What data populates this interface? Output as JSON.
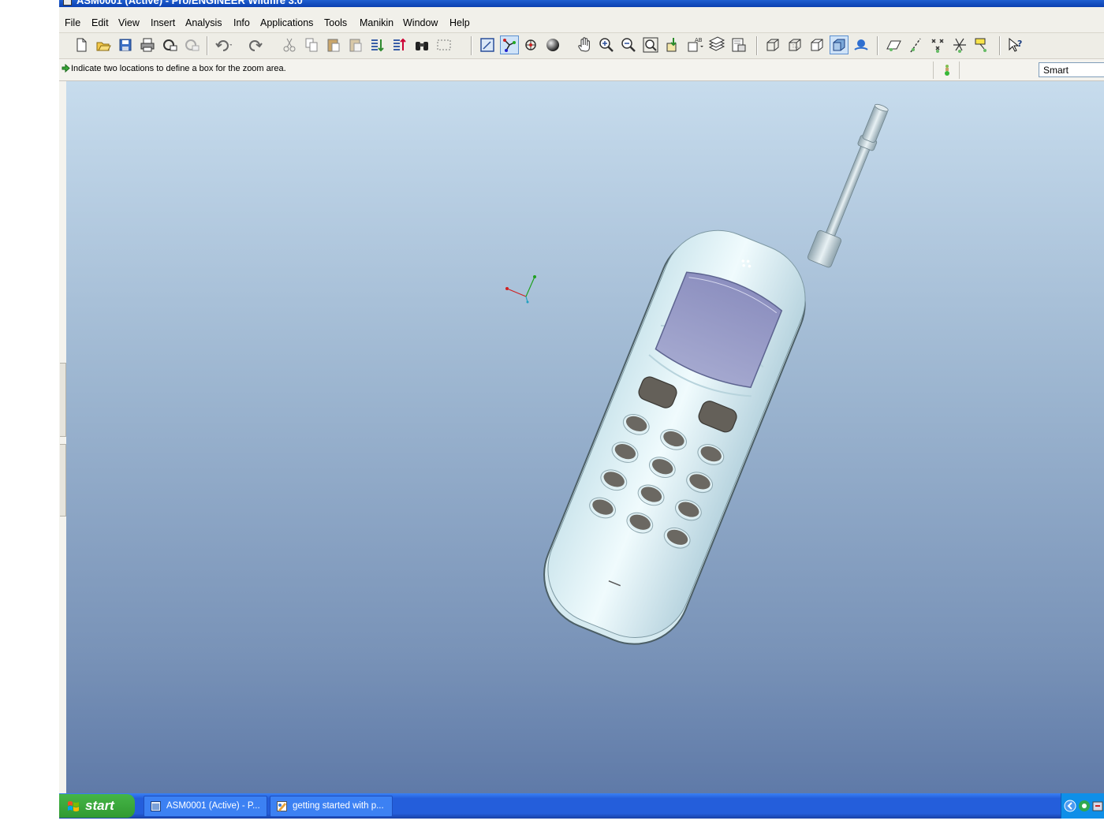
{
  "window": {
    "title": "ASM0001 (Active) - Pro/ENGINEER Wildfire 3.0"
  },
  "menu": [
    "File",
    "Edit",
    "View",
    "Insert",
    "Analysis",
    "Info",
    "Applications",
    "Tools",
    "Manikin",
    "Window",
    "Help"
  ],
  "toolbar": {
    "groups": [
      [
        "new-icon",
        "open-icon",
        "save-icon",
        "print-icon",
        "send-mail-icon",
        "send-link-icon"
      ],
      [
        "undo-icon",
        "redo-icon",
        "cut-icon",
        "copy-icon",
        "paste-icon",
        "paste-special-icon",
        "regenerate-icon",
        "regen-manager-icon",
        "find-icon",
        "select-box-icon"
      ],
      [
        "repaint-icon",
        "spin-center-icon",
        "orient-mode-icon",
        "appearance-icon",
        "pan-icon",
        "zoom-in-icon",
        "zoom-out-icon",
        "refit-icon",
        "reorient-icon",
        "saved-views-icon",
        "layers-icon",
        "view-manager-icon"
      ],
      [
        "wireframe-icon",
        "hidden-line-icon",
        "no-hidden-icon",
        "shading-icon",
        "enhanced-realism-icon"
      ],
      [
        "datum-planes-icon",
        "datum-axes-icon",
        "datum-points-icon",
        "coordinate-systems-icon",
        "annotations-icon"
      ],
      [
        "context-help-icon"
      ]
    ],
    "active": [
      "spin-center-icon",
      "shading-icon"
    ]
  },
  "message": {
    "text": "Indicate two locations to define a box for the zoom area."
  },
  "filter": {
    "value": "Smart"
  },
  "taskbar": {
    "start_label": "start",
    "tasks": [
      {
        "label": "ASM0001 (Active) - P...",
        "icon": "proe-window-icon"
      },
      {
        "label": "getting started with p...",
        "icon": "paint-document-icon"
      }
    ]
  },
  "colors": {
    "viewport_top": "#c7dced",
    "viewport_bottom": "#5f7aa8",
    "phone_body": "#e6f5f8",
    "phone_screen": "#9a9ec8",
    "key": "#6b6862",
    "taskbar": "#245edb"
  }
}
